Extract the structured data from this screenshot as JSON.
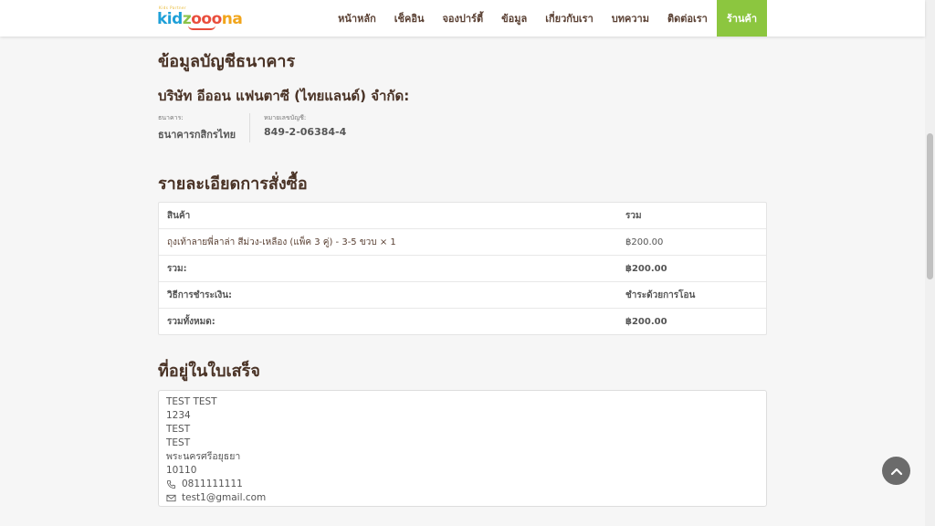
{
  "header": {
    "logo": {
      "tagline": "Kids Partner",
      "word_k": "kid",
      "word_z": "z",
      "word_o": "ooo",
      "word_na": "na"
    },
    "nav": [
      {
        "label": "หน้าหลัก"
      },
      {
        "label": "เช็คอิน"
      },
      {
        "label": "จองปาร์ตี้"
      },
      {
        "label": "ข้อมูล"
      },
      {
        "label": "เกี่ยวกับเรา"
      },
      {
        "label": "บทความ"
      },
      {
        "label": "ติดต่อเรา"
      },
      {
        "label": "ร้านค้า"
      }
    ],
    "active_color": "#8cc63f"
  },
  "bank": {
    "title": "ข้อมูลบัญชีธนาคาร",
    "company": "บริษัท อีออน แฟนตาซี (ไทยแลนด์) จำกัด:",
    "bank_label": "ธนาคาร:",
    "bank_value": "ธนาคารกสิกรไทย",
    "account_label": "หมายเลขบัญชี:",
    "account_value": "849-2-06384-4"
  },
  "order": {
    "title": "รายละเอียดการสั่งซื้อ",
    "headers": {
      "product": "สินค้า",
      "total": "รวม"
    },
    "item": {
      "name": "ถุงเท้าลายพี่ลาล่า สีม่วง-เหลือง (แพ็ค 3 คู่) - 3-5 ขวบ × 1",
      "price": "฿200.00"
    },
    "subtotal": {
      "label": "รวม:",
      "value": "฿200.00"
    },
    "payment": {
      "label": "วิธีการชำระเงิน:",
      "value": "ชำระด้วยการโอน"
    },
    "grand_total": {
      "label": "รวมทั้งหมด:",
      "value": "฿200.00"
    }
  },
  "address": {
    "title": "ที่อยู่ในใบเสร็จ",
    "name": "TEST TEST",
    "line1": "1234",
    "line2": "TEST",
    "line3": "TEST",
    "province": "พระนครศรีอยุธยา",
    "postcode": "10110",
    "phone": "0811111111",
    "email": "test1@gmail.com"
  }
}
